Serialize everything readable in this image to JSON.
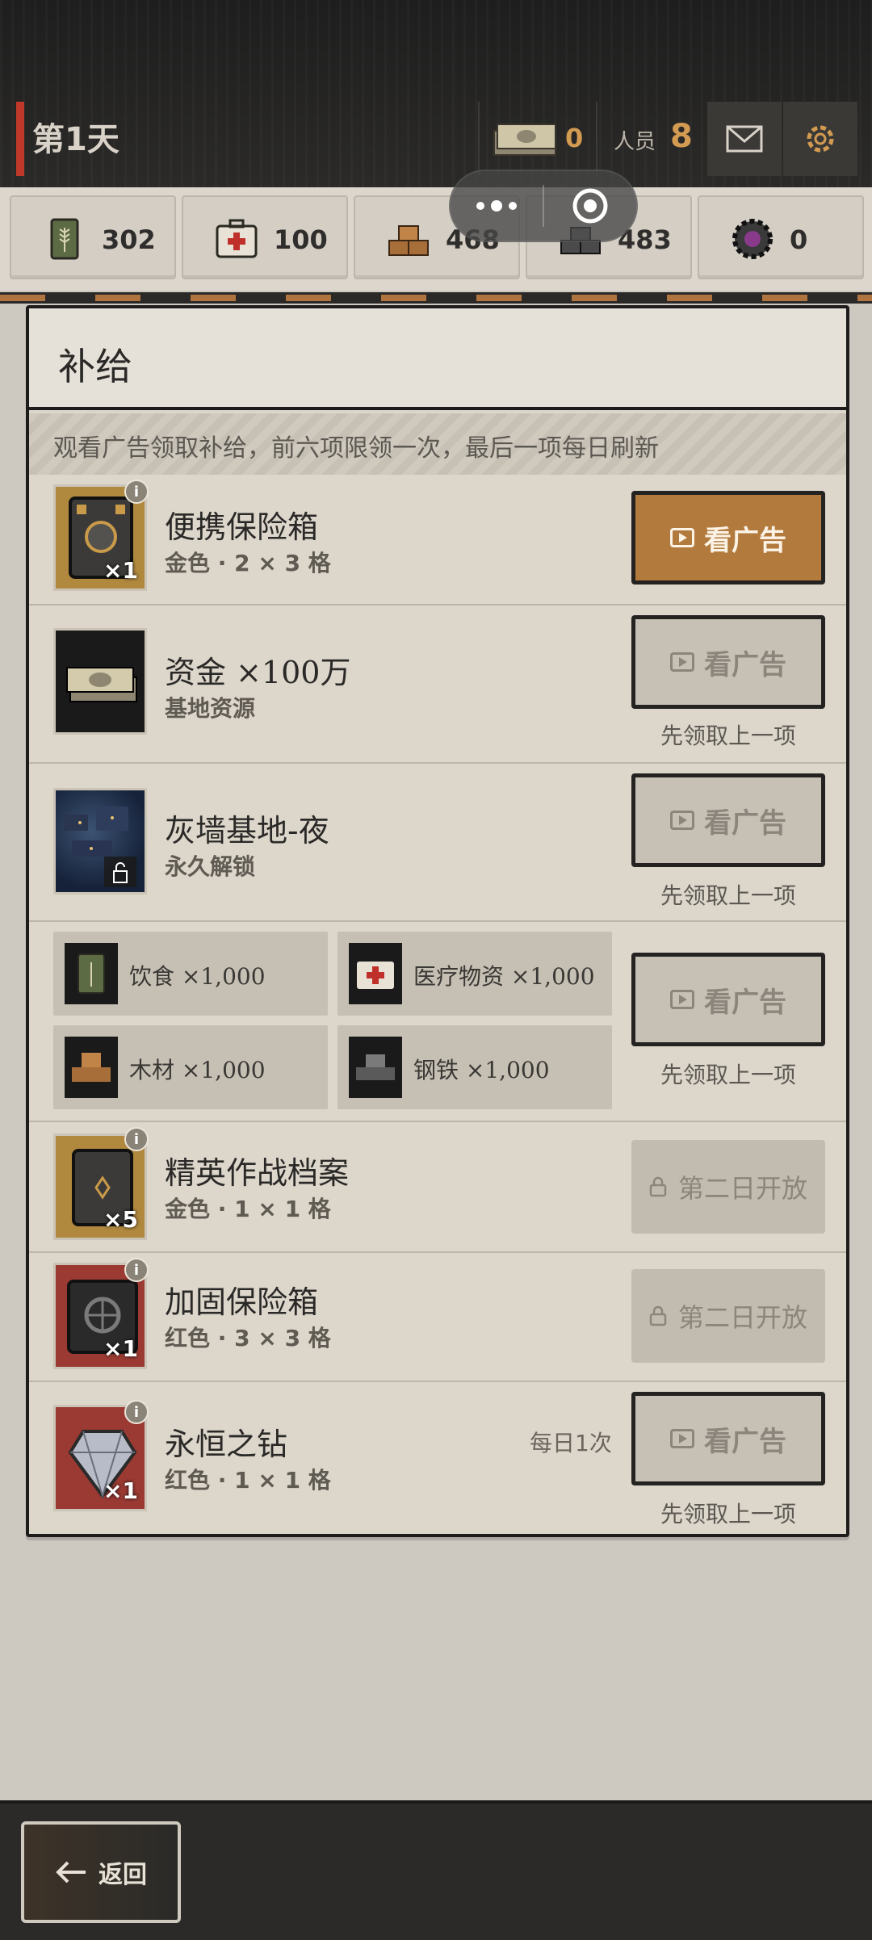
{
  "header": {
    "day_title": "第1天",
    "money_value": "0",
    "staff_label": "人员",
    "staff_value": "8"
  },
  "resources": [
    {
      "icon": "food-can-icon",
      "value": "302"
    },
    {
      "icon": "medkit-icon",
      "value": "100"
    },
    {
      "icon": "wood-icon",
      "value": "468"
    },
    {
      "icon": "steel-icon",
      "value": "483"
    },
    {
      "icon": "gear-chip-icon",
      "value": "0"
    }
  ],
  "panel": {
    "title": "补给",
    "notice": "观看广告领取补给，前六项限领一次，最后一项每日刷新"
  },
  "items": [
    {
      "name": "便携保险箱",
      "sub": "金色 · 2 × 3 格",
      "mult": "×1",
      "button": "看广告",
      "hint": ""
    },
    {
      "name": "资金 ×100万",
      "sub": "基地资源",
      "button": "看广告",
      "hint": "先领取上一项"
    },
    {
      "name": "灰墙基地-夜",
      "sub": "永久解锁",
      "button": "看广告",
      "hint": "先领取上一项"
    },
    {
      "name": "精英作战档案",
      "sub": "金色 · 1 × 1 格",
      "mult": "×5",
      "button": "第二日开放"
    },
    {
      "name": "加固保险箱",
      "sub": "红色 · 3 × 3 格",
      "mult": "×1",
      "button": "第二日开放"
    },
    {
      "name": "永恒之钻",
      "sub": "红色 · 1 × 1 格",
      "mult": "×1",
      "daily": "每日1次",
      "button": "看广告",
      "hint": "先领取上一项"
    }
  ],
  "bundle": {
    "items": [
      {
        "label": "饮食 ×1,000"
      },
      {
        "label": "医疗物资 ×1,000"
      },
      {
        "label": "木材 ×1,000"
      },
      {
        "label": "钢铁 ×1,000"
      }
    ],
    "button": "看广告",
    "hint": "先领取上一项"
  },
  "footer": {
    "back_label": "返回"
  },
  "colors": {
    "accent": "#b27a3c",
    "value_orange": "#d39a52",
    "panel_bg": "#dcd6cb"
  }
}
